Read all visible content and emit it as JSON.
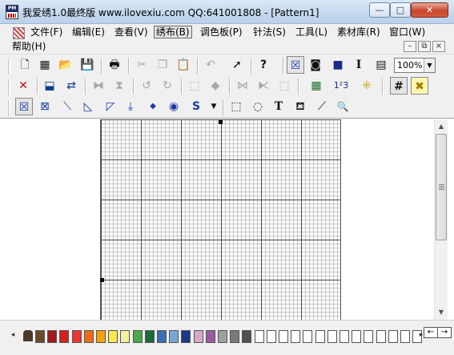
{
  "window": {
    "title": "我爱绣1.0最终版 www.ilovexiu.com QQ:641001808 - [Pattern1]",
    "icon": "app-pm-icon",
    "app_icon_text": "PM",
    "minimize_icon": "—",
    "maximize_icon": "□",
    "close_icon": "✕"
  },
  "menu": {
    "items": [
      {
        "label": "文件(F)"
      },
      {
        "label": "编辑(E)"
      },
      {
        "label": "查看(V)"
      },
      {
        "label": "绣布(B)"
      },
      {
        "label": "调色板(P)"
      },
      {
        "label": "针法(S)"
      },
      {
        "label": "工具(L)"
      },
      {
        "label": "素材库(R)"
      },
      {
        "label": "窗口(W)"
      },
      {
        "label": "帮助(H)"
      }
    ],
    "mdi_minimize": "–",
    "mdi_restore": "⧉",
    "mdi_close": "×"
  },
  "toolbar": {
    "row1": [
      {
        "icon": "new-file-icon",
        "glyph": "🗋"
      },
      {
        "icon": "new-pattern-icon",
        "glyph": "▦"
      },
      {
        "icon": "open-icon",
        "glyph": "📂"
      },
      {
        "icon": "save-icon",
        "glyph": "💾"
      },
      {
        "icon": "print-icon",
        "glyph": "🖶"
      },
      {
        "icon": "cut-icon",
        "glyph": "✂"
      },
      {
        "icon": "copy-icon",
        "glyph": "❐"
      },
      {
        "icon": "paste-icon",
        "glyph": "📋"
      },
      {
        "icon": "undo-icon",
        "glyph": "↶"
      },
      {
        "icon": "import-icon",
        "glyph": "➚"
      },
      {
        "icon": "help-icon",
        "glyph": "?"
      },
      {
        "icon": "cross-stitch-view-icon",
        "glyph": "☒"
      },
      {
        "icon": "symbol-view-icon",
        "glyph": "◙"
      },
      {
        "icon": "color-view-icon",
        "glyph": "■"
      },
      {
        "icon": "text-cursor-icon",
        "glyph": "I"
      },
      {
        "icon": "list-icon",
        "glyph": "▤"
      }
    ],
    "zoom_value": "100%",
    "zoom_arrow": "▼",
    "row2": [
      {
        "icon": "delete-icon",
        "glyph": "✕"
      },
      {
        "icon": "select-move-icon",
        "glyph": "⬓"
      },
      {
        "icon": "swap-icon",
        "glyph": "⇄"
      },
      {
        "icon": "flip-horizontal-icon",
        "glyph": "⧓"
      },
      {
        "icon": "flip-vertical-icon",
        "glyph": "⧗"
      },
      {
        "icon": "rotate-left-icon",
        "glyph": "↺"
      },
      {
        "icon": "rotate-right-icon",
        "glyph": "↻"
      },
      {
        "icon": "select-fill-icon",
        "glyph": "⬚"
      },
      {
        "icon": "bucket-icon",
        "glyph": "◆"
      },
      {
        "icon": "mirror-icon",
        "glyph": "⋈"
      },
      {
        "icon": "mirror-v-icon",
        "glyph": "⧔"
      },
      {
        "icon": "frame-icon",
        "glyph": "⬚"
      },
      {
        "icon": "color-grid-icon",
        "glyph": "▦"
      },
      {
        "icon": "numbering-icon",
        "glyph": "1²3"
      },
      {
        "icon": "pattern-icon",
        "glyph": "⁜"
      },
      {
        "icon": "grid-toggle-icon",
        "glyph": "#"
      },
      {
        "icon": "cross-toggle-icon",
        "glyph": "✖"
      }
    ],
    "row3": [
      {
        "icon": "full-cross-icon",
        "glyph": "☒"
      },
      {
        "icon": "half-cross-icon",
        "glyph": "⊠"
      },
      {
        "icon": "backstitch-icon",
        "glyph": "⟍"
      },
      {
        "icon": "quarter-stitch-icon",
        "glyph": "◺"
      },
      {
        "icon": "three-quarter-icon",
        "glyph": "◸"
      },
      {
        "icon": "long-stitch-icon",
        "glyph": "⤓"
      },
      {
        "icon": "french-knot-icon",
        "glyph": "◆"
      },
      {
        "icon": "bead-icon",
        "glyph": "◉"
      },
      {
        "icon": "s-stitch-icon",
        "glyph": "S"
      },
      {
        "icon": "dropdown-arrow-icon",
        "glyph": "▼"
      },
      {
        "icon": "rect-select-icon",
        "glyph": "⬚"
      },
      {
        "icon": "lasso-icon",
        "glyph": "◌"
      },
      {
        "icon": "text-tool-icon",
        "glyph": "T"
      },
      {
        "icon": "fill-tool-icon",
        "glyph": "⛾"
      },
      {
        "icon": "eyedropper-icon",
        "glyph": "⟋"
      },
      {
        "icon": "zoom-icon",
        "glyph": "🔍"
      }
    ]
  },
  "scrollbar": {
    "up": "▲",
    "down": "▼"
  },
  "palette": {
    "left_arrow": "◂",
    "right_arrow": "▸",
    "nav_left": "←",
    "nav_right": "→",
    "colors": [
      "#6a4a2a",
      "#a11b1b",
      "#d42020",
      "#f03535",
      "#f26a1a",
      "#f5a10c",
      "#fbe84a",
      "#f4f0a0",
      "#4aa84a",
      "#1c6b3a",
      "#3a6fb5",
      "#7aa7d8",
      "#1b3a8a",
      "#d8a8c8",
      "#9a5aa0",
      "#a0a0a0",
      "#7a7a7a",
      "#505050",
      "#ffffff",
      "#ffffff",
      "#ffffff",
      "#ffffff",
      "#ffffff",
      "#ffffff",
      "#ffffff",
      "#ffffff",
      "#ffffff",
      "#ffffff",
      "#ffffff",
      "#ffffff",
      "#ffffff",
      "#ffffff"
    ]
  }
}
